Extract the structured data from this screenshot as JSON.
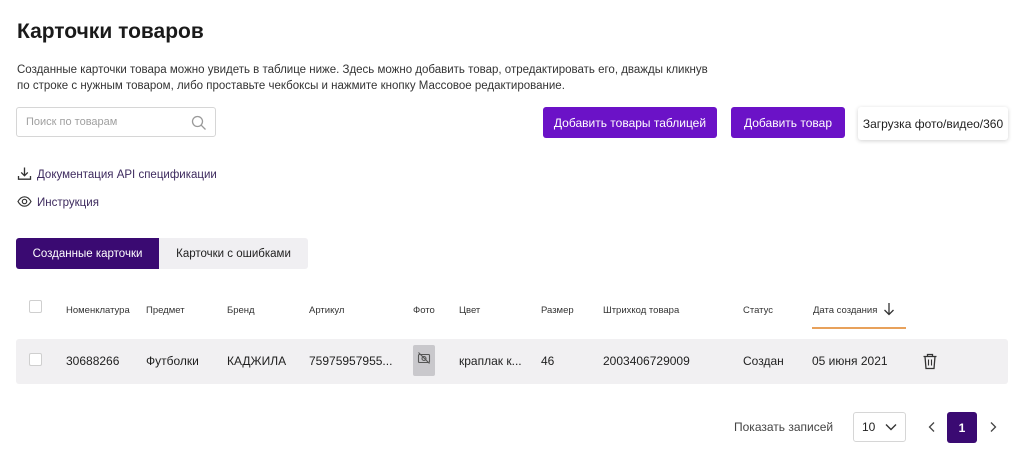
{
  "header": {
    "title": "Карточки товаров",
    "description": "Созданные карточки товара можно увидеть в таблице ниже. Здесь можно добавить товар, отредактировать его, дважды кликнув по строке с нужным товаром, либо проставьте чекбоксы и нажмите кнопку Массовое редактирование."
  },
  "search": {
    "placeholder": "Поиск по товарам",
    "value": ""
  },
  "toolbar": {
    "add_table_label": "Добавить товары таблицей",
    "add_label": "Добавить товар",
    "upload_label": "Загрузка фото/видео/360"
  },
  "links": {
    "docs": "Документация API спецификации",
    "instruction": "Инструкция"
  },
  "tabs": [
    {
      "label": "Созданные карточки",
      "active": true
    },
    {
      "label": "Карточки с ошибками",
      "active": false
    }
  ],
  "table": {
    "columns": [
      "Номенклатура",
      "Предмет",
      "Бренд",
      "Артикул",
      "Фото",
      "Цвет",
      "Размер",
      "Штрихкод товара",
      "Статус",
      "Дата создания"
    ],
    "sorted_column": "Дата создания",
    "rows": [
      {
        "nomenclature": "30688266",
        "subject": "Футболки",
        "brand": "КАДЖИЛА",
        "article": "75975957955...",
        "color": "краплак к...",
        "size": "46",
        "barcode": "2003406729009",
        "status": "Создан",
        "created": "05 июня 2021"
      }
    ]
  },
  "pagination": {
    "page_size_label": "Показать записей",
    "page_size": "10",
    "current_page": "1"
  },
  "colors": {
    "primary": "#6b12c7",
    "dark_purple": "#3a0a72",
    "sort_accent": "#e8a15b",
    "row_bg": "#f1f0f2"
  },
  "icons": [
    "search-icon",
    "download-icon",
    "eye-icon",
    "sort-down-icon",
    "no-photo-icon",
    "trash-icon",
    "chevron-down-icon",
    "chevron-left-icon",
    "chevron-right-icon"
  ]
}
